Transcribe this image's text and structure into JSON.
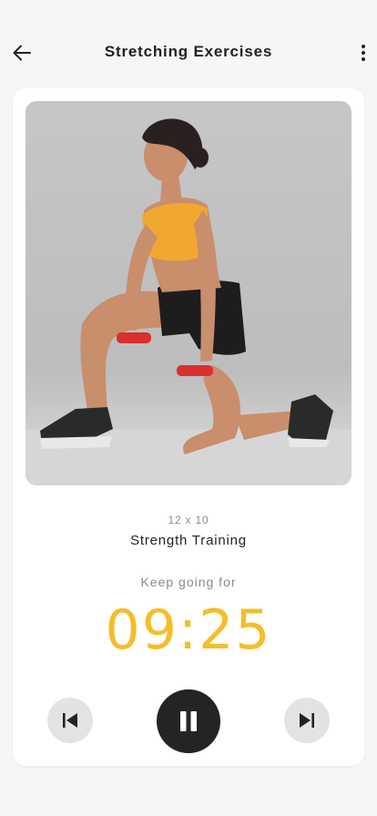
{
  "header": {
    "title": "Stretching Exercises",
    "back_icon": "arrow-left-icon",
    "menu_icon": "more-vertical-icon"
  },
  "workout": {
    "image_alt": "Woman in kneeling lunge holding red dumbbells",
    "reps": "12 x 10",
    "name": "Strength Training",
    "prompt": "Keep going for",
    "time_remaining": "09:25"
  },
  "controls": {
    "previous_icon": "skip-previous-icon",
    "pause_icon": "pause-icon",
    "next_icon": "skip-next-icon"
  },
  "colors": {
    "accent": "#f4bd2a",
    "pause_button": "#242424",
    "secondary_button": "#e3e3e3"
  }
}
